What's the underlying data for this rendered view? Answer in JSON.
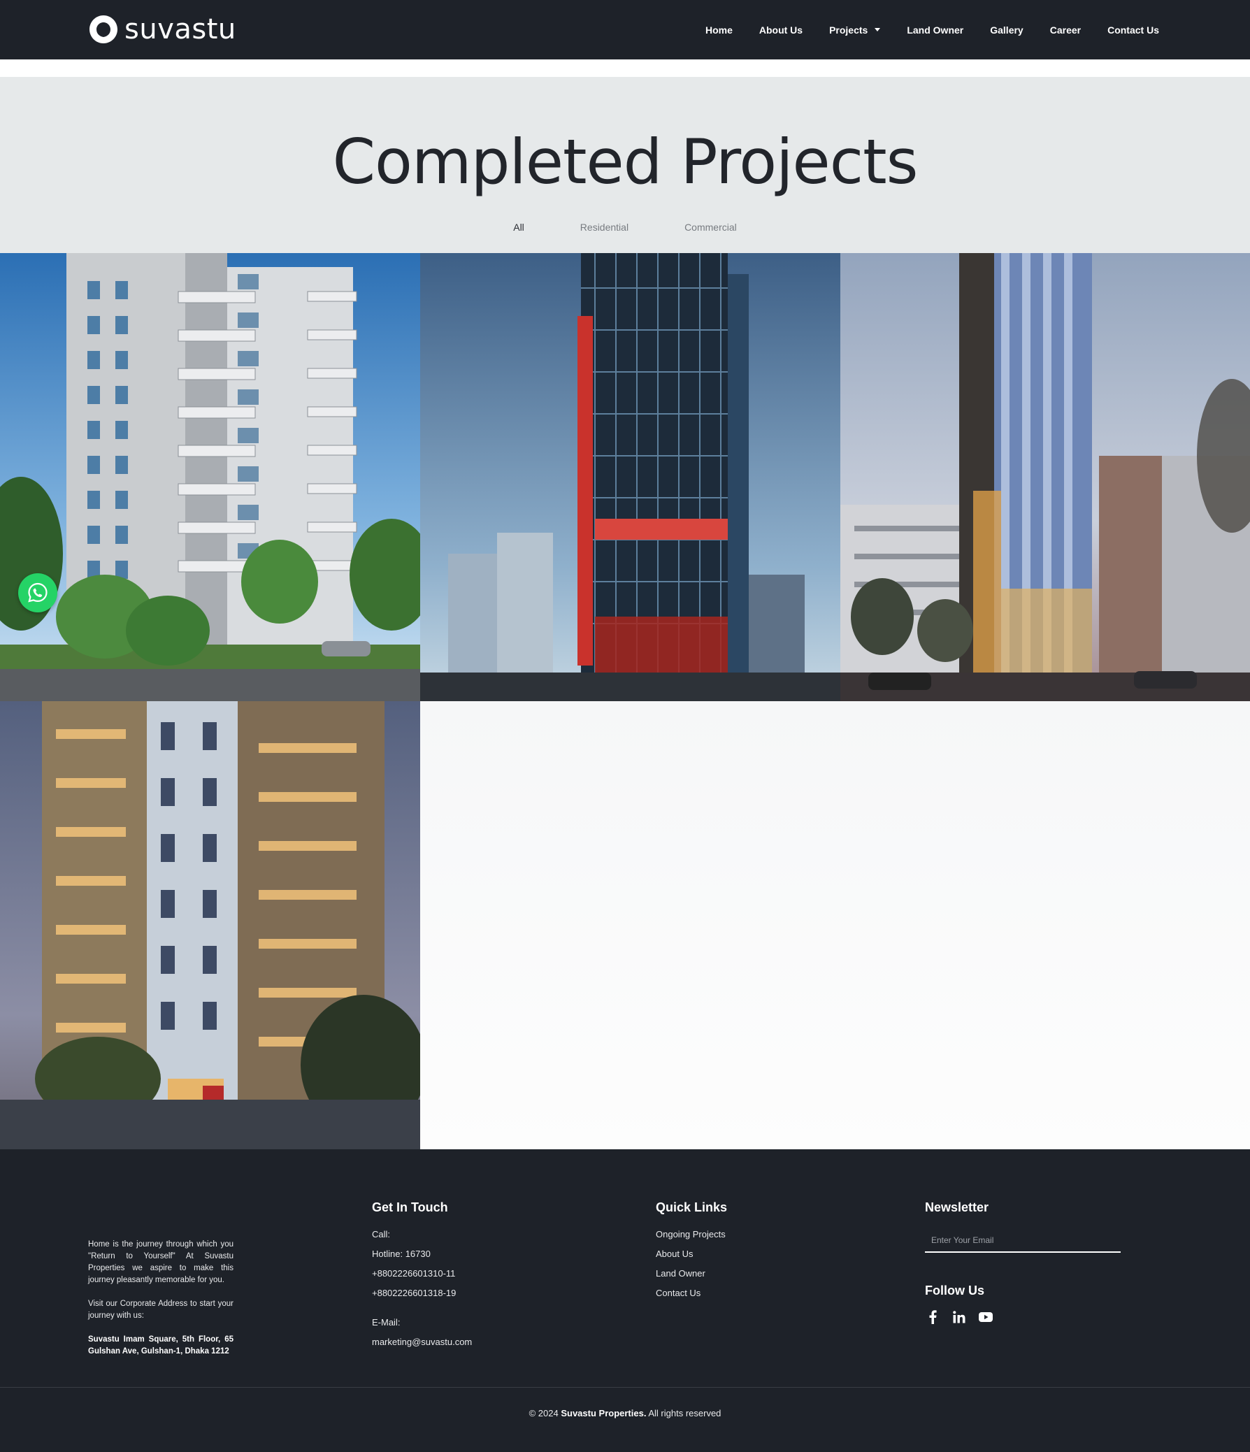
{
  "header": {
    "brand": "suvastu",
    "nav": [
      {
        "label": "Home"
      },
      {
        "label": "About Us"
      },
      {
        "label": "Projects",
        "has_dropdown": true
      },
      {
        "label": "Land Owner"
      },
      {
        "label": "Gallery"
      },
      {
        "label": "Career"
      },
      {
        "label": "Contact Us"
      }
    ]
  },
  "hero": {
    "title": "Completed Projects",
    "filters": [
      "All",
      "Residential",
      "Commercial"
    ],
    "active_filter": "All"
  },
  "projects": [
    {
      "image": "white residential apartment tower with balconies"
    },
    {
      "image": "glass commercial tower with red lit facade"
    },
    {
      "image": "tall glass commercial tower at dusk"
    },
    {
      "image": "residential tower with lit balconies at dusk"
    }
  ],
  "footer": {
    "about": {
      "intro": "Home is the journey through which you \"Return to Yourself\" At Suvastu Properties we aspire to make this journey pleasantly memorable for you.",
      "visit": "Visit our Corporate Address to start your journey with us:",
      "address": "Suvastu Imam Square, 5th Floor, 65 Gulshan Ave, Gulshan-1, Dhaka 1212"
    },
    "contact": {
      "title": "Get In Touch",
      "call_label": "Call:",
      "hotline": "Hotline: 16730",
      "phone1": "+8802226601310-11",
      "phone2": "+8802226601318-19",
      "email_label": "E-Mail:",
      "email": "marketing@suvastu.com"
    },
    "quick_links": {
      "title": "Quick Links",
      "items": [
        "Ongoing Projects",
        "About Us",
        "Land Owner",
        "Contact Us"
      ]
    },
    "newsletter": {
      "title": "Newsletter",
      "placeholder": "Enter Your Email",
      "follow_title": "Follow Us",
      "socials": [
        "facebook-icon",
        "linkedin-icon",
        "youtube-icon"
      ]
    },
    "copyright_prefix": "© 2024",
    "copyright_company": "Suvastu Properties.",
    "copyright_suffix": "All rights reserved"
  },
  "colors": {
    "header_bg": "#1e2229",
    "hero_bg": "#e6e9ea",
    "whatsapp": "#25d366"
  }
}
